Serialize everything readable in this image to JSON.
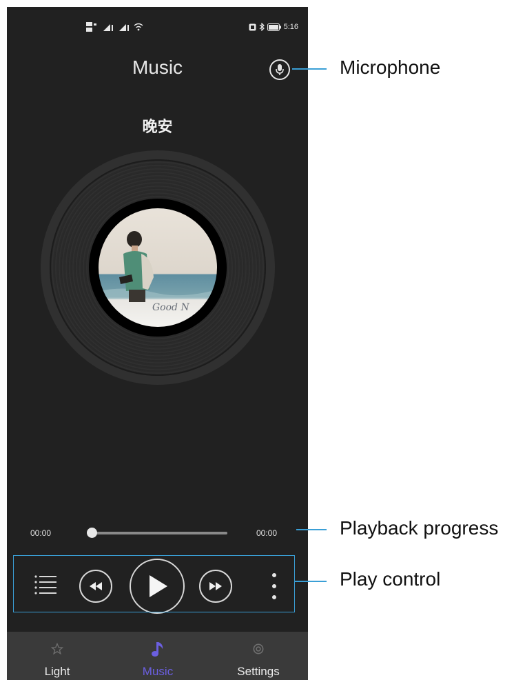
{
  "status_bar": {
    "time": "5:16"
  },
  "header": {
    "title": "Music"
  },
  "song": {
    "title": "晚安"
  },
  "album_art": {
    "signature_text": "Good N"
  },
  "playback": {
    "current_time": "00:00",
    "total_time": "00:00",
    "progress": 0
  },
  "tabs": [
    {
      "label": "Light",
      "icon": "star-icon",
      "active": false
    },
    {
      "label": "Music",
      "icon": "music-note-icon",
      "active": true
    },
    {
      "label": "Settings",
      "icon": "gear-icon",
      "active": false
    }
  ],
  "annotations": {
    "microphone": "Microphone",
    "playback_progress": "Playback progress",
    "play_control": "Play control"
  },
  "colors": {
    "background": "#212121",
    "accent": "#6b5fe0",
    "annotation": "#3a9fd6",
    "tab_bar": "#3a3a3a"
  }
}
